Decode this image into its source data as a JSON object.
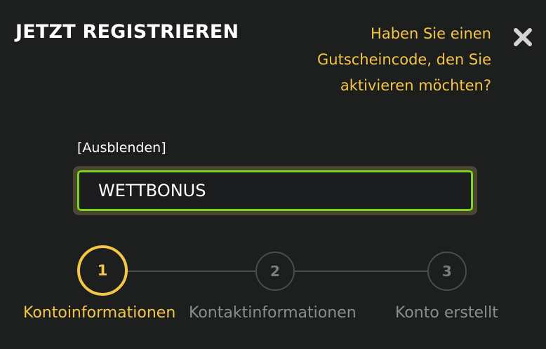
{
  "header": {
    "title": "JETZT REGISTRIEREN",
    "voucher_question": "Haben Sie einen Gutscheincode, den Sie aktivieren möchten?",
    "close_icon": "close-icon"
  },
  "voucher": {
    "hide_label": "[Ausblenden]",
    "code_value": "WETTBONUS"
  },
  "steps": [
    {
      "number": "1",
      "label": "Kontoinformationen",
      "state": "active"
    },
    {
      "number": "2",
      "label": "Kontaktinformationen",
      "state": "inactive"
    },
    {
      "number": "3",
      "label": "Konto erstellt",
      "state": "inactive"
    }
  ],
  "colors": {
    "background": "#1d1f1f",
    "accent": "#f4c646",
    "input_border": "#7ed321",
    "inactive": "#4a4c4d"
  }
}
